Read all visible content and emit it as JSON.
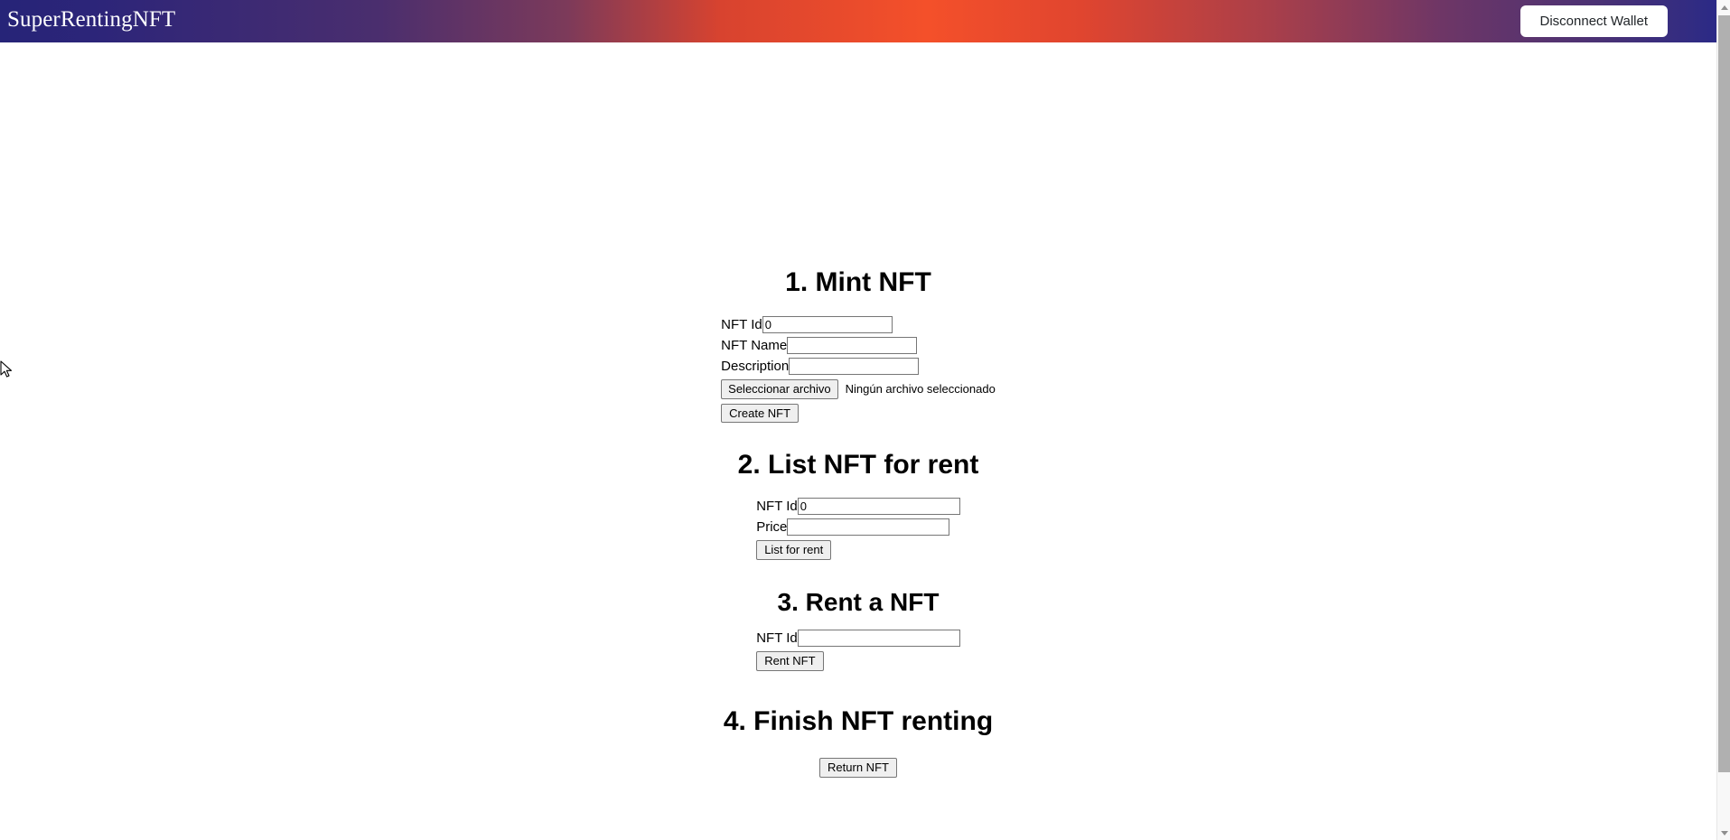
{
  "header": {
    "brand": "SuperRentingNFT",
    "disconnect_label": "Disconnect Wallet",
    "gradient_start": "#262478",
    "gradient_mid": "#f4502a",
    "gradient_end": "#2b2a86",
    "button_bg": "#ffffff",
    "button_text_color": "#212529"
  },
  "sections": {
    "mint": {
      "title": "1. Mint NFT",
      "nft_id_label": "NFT Id",
      "nft_id_value": "0",
      "nft_name_label": "NFT Name",
      "nft_name_value": "",
      "description_label": "Description",
      "description_value": "",
      "file_button_label": "Seleccionar archivo",
      "file_status": "Ningún archivo seleccionado",
      "submit_label": "Create NFT"
    },
    "list": {
      "title": "2. List NFT for rent",
      "nft_id_label": "NFT Id",
      "nft_id_value": "0",
      "price_label": "Price",
      "price_value": "",
      "submit_label": "List for rent"
    },
    "rent": {
      "title": "3. Rent a NFT",
      "nft_id_label": "NFT Id",
      "nft_id_value": "",
      "submit_label": "Rent NFT"
    },
    "finish": {
      "title": "4. Finish NFT renting",
      "submit_label": "Return NFT"
    }
  },
  "scrollbar": {
    "up_arrow": "scroll-up-arrow",
    "down_arrow": "scroll-down-arrow",
    "thumb_color": "#b0b0b0"
  }
}
